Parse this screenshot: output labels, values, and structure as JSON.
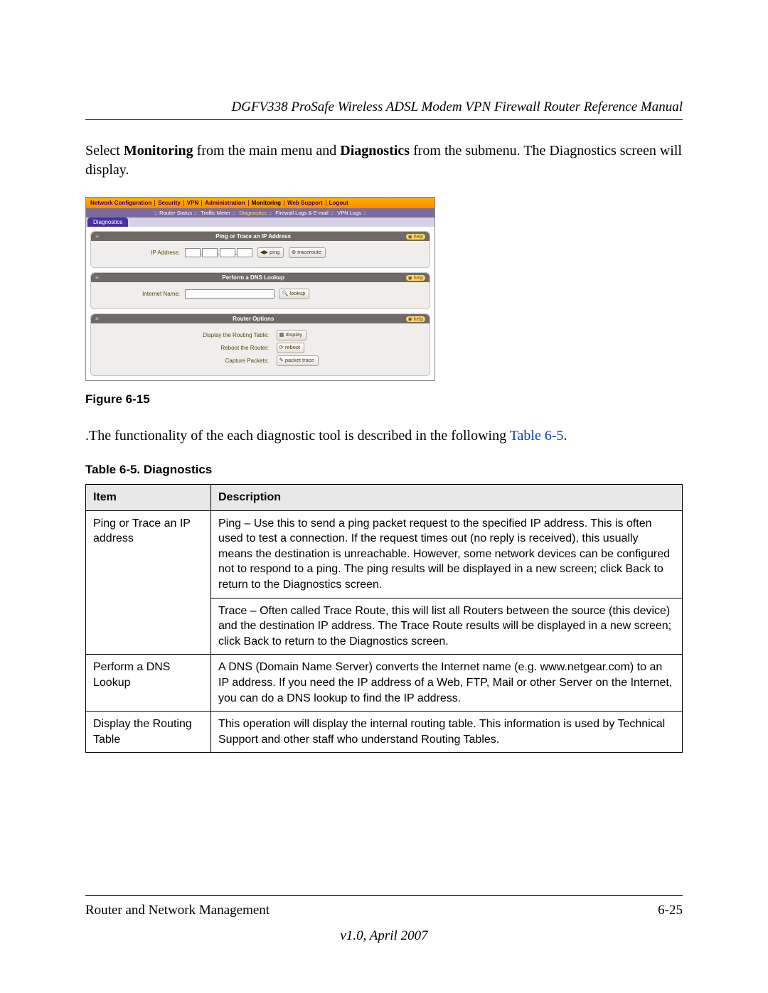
{
  "header": "DGFV338 ProSafe Wireless ADSL Modem VPN Firewall Router Reference Manual",
  "intro": {
    "pre": "Select ",
    "b1": "Monitoring",
    "mid1": " from the main menu and ",
    "b2": "Diagnostics",
    "post": " from the submenu. The Diagnostics screen will display."
  },
  "shot": {
    "topnav": [
      "Network Configuration",
      "Security",
      "VPN",
      "Administration",
      "Monitoring",
      "Web Support",
      "Logout"
    ],
    "subnav": [
      "Router Status",
      "Traffic Meter",
      "Diagnostics",
      "Firewall Logs & E-mail",
      "VPN Logs"
    ],
    "tab": "Diagnostics",
    "help": "help",
    "panel1": {
      "title": "Ping or Trace an IP Address",
      "label": "IP Address:",
      "ping": "ping",
      "traceroute": "traceroute"
    },
    "panel2": {
      "title": "Perform a DNS Lookup",
      "label": "Internet Name:",
      "lookup": "lookup"
    },
    "panel3": {
      "title": "Router Options",
      "row1_label": "Display the Routing Table:",
      "row1_btn": "display",
      "row2_label": "Reboot the Router:",
      "row2_btn": "reboot",
      "row3_label": "Capture Packets:",
      "row3_btn": "packet trace"
    }
  },
  "fig_caption": "Figure 6-15",
  "func_para": {
    "pre": ".The functionality of the each diagnostic tool is described in the following ",
    "link": "Table 6-5",
    "post": "."
  },
  "table_caption": "Table 6-5.  Diagnostics",
  "th": {
    "c1": "Item",
    "c2": "Description"
  },
  "rows": {
    "r1c1": "Ping or Trace an IP address",
    "r1c2": "Ping – Use this to send a ping packet request to the specified IP address. This is often used to test a connection. If the request times out (no reply is received), this usually means the destination is unreachable. However, some network devices can be configured not to respond to a ping. The ping results will be displayed in a new screen; click Back to return to the Diagnostics screen.",
    "r1c2b": "Trace – Often called Trace Route, this will list all Routers between the source (this device) and the destination IP address. The Trace Route results will be displayed in a new screen; click Back to return to the Diagnostics screen.",
    "r2c1": "Perform a DNS Lookup",
    "r2c2": "A DNS (Domain Name Server) converts the Internet name (e.g. www.netgear.com) to an IP address. If you need the IP address of a Web, FTP, Mail or other Server on the Internet, you can do a DNS lookup to find the IP address.",
    "r3c1": "Display the Routing Table",
    "r3c2": "This operation will display the internal routing table. This information is used by Technical Support and other staff who understand Routing Tables."
  },
  "footer": {
    "left": "Router and Network Management",
    "right": "6-25",
    "version": "v1.0, April 2007"
  }
}
